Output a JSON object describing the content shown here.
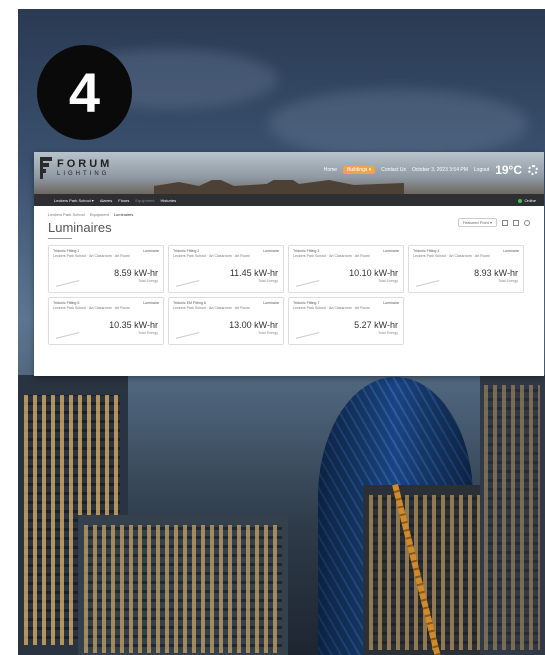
{
  "step_badge": "4",
  "app": {
    "logo": {
      "line1": "FORUM",
      "line2": "LIGHTING"
    },
    "topnav": {
      "home": "Home",
      "buildings": "Buildings ▾",
      "contact": "Contact Us",
      "datetime": "October 3, 2023 3:54 PM",
      "logout": "Logout",
      "temperature": "19°C"
    },
    "subnav": {
      "school": "Leckers Park School ▾",
      "alarms": "Alarms",
      "floors": "Floors",
      "equipment": "Equipment",
      "histories": "Histories",
      "status": "Online"
    },
    "breadcrumb": [
      "Leckers Park School",
      "Equipment",
      "Luminaires"
    ],
    "page_title": "Luminaires",
    "tools": {
      "filter": "Featured Point ▾"
    },
    "cards": [
      {
        "name": "Tridonic Fitting 1",
        "type": "Luminaire",
        "location": "Leckers Park School · Art Classroom · Art Room",
        "value": "8.59 kW-hr",
        "label": "Total Energy"
      },
      {
        "name": "Tridonic Fitting 2",
        "type": "Luminaire",
        "location": "Leckers Park School · Art Classroom · Art Room",
        "value": "11.45 kW-hr",
        "label": "Total Energy"
      },
      {
        "name": "Tridonic Fitting 3",
        "type": "Luminaire",
        "location": "Leckers Park School · Art Classroom · Art Room",
        "value": "10.10 kW-hr",
        "label": "Total Energy"
      },
      {
        "name": "Tridonic Fitting 4",
        "type": "Luminaire",
        "location": "Leckers Park School · Art Classroom · Art Room",
        "value": "8.93 kW-hr",
        "label": "Total Energy"
      },
      {
        "name": "Tridonic Fitting 5",
        "type": "Luminaire",
        "location": "Leckers Park School · Art Classroom · Art Room",
        "value": "10.35 kW-hr",
        "label": "Total Energy"
      },
      {
        "name": "Tridonic EM Fitting 6",
        "type": "Luminaire",
        "location": "Leckers Park School · Art Classroom · Art Room",
        "value": "13.00 kW-hr",
        "label": "Total Energy"
      },
      {
        "name": "Tridonic Fitting 7",
        "type": "Luminaire",
        "location": "Leckers Park School · Art Classroom · Art Room",
        "value": "5.27 kW-hr",
        "label": "Total Energy"
      }
    ]
  }
}
